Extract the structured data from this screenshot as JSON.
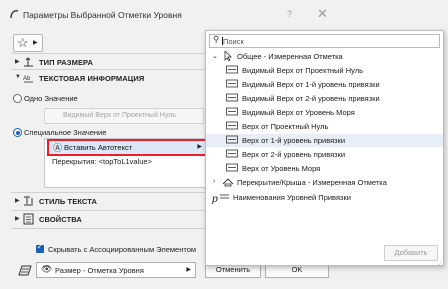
{
  "dialog": {
    "title": "Параметры Выбранной Отметки Уровня",
    "help_label": "?",
    "close_label": "✕",
    "sections": {
      "dimension_type": "ТИП РАЗМЕРА",
      "text_info": "ТЕКСТОВАЯ ИНФОРМАЦИЯ",
      "text_style": "СТИЛЬ ТЕКСТА",
      "properties": "СВОЙСТВА"
    },
    "single_value_label": "Одно Значение",
    "single_value_field": "Видимый Верх от Проектный Нуль",
    "special_value_label": "Специальное Значение",
    "insert_autotext_label": "Вставить Автотекст",
    "textarea_value": "Перекрытия: <topToL1value>",
    "hide_with_associated_label": "Скрывать с Ассоциированным Элементом",
    "preset_label": "Размер - Отметка Уровня",
    "cancel_label": "Отменить",
    "ok_label": "OK"
  },
  "popup": {
    "search_placeholder": "Поиск",
    "tree": [
      {
        "label": "Общее - Измеренная Отметка",
        "level": 0,
        "expanded": true,
        "icon": "cursor-icon"
      },
      {
        "label": "Видимый Верх от Проектный Нуль",
        "level": 1,
        "icon": "level-field-icon"
      },
      {
        "label": "Видимый Верх от 1-й уровень привязки",
        "level": 1,
        "icon": "level-field-icon"
      },
      {
        "label": "Видимый Верх от 2-й уровень привязки",
        "level": 1,
        "icon": "level-field-icon"
      },
      {
        "label": "Видимый Верх от Уровень Моря",
        "level": 1,
        "icon": "level-field-icon"
      },
      {
        "label": "Верх от Проектный Нуль",
        "level": 1,
        "icon": "level-field-icon"
      },
      {
        "label": "Верх от 1-й уровень привязки",
        "level": 1,
        "icon": "level-field-icon",
        "selected": true
      },
      {
        "label": "Верх от 2-й уровень привязки",
        "level": 1,
        "icon": "level-field-icon"
      },
      {
        "label": "Верх от Уровень Моря",
        "level": 1,
        "icon": "level-field-icon"
      },
      {
        "label": "Перекрытие/Крыша - Измеренная Отметка",
        "level": 0,
        "expanded": false,
        "icon": "slab-roof-icon"
      },
      {
        "label": "Наименования Уровней Привязки",
        "level": 0,
        "icon": "reference-level-icon"
      }
    ],
    "add_label": "Добавить"
  },
  "colors": {
    "accent": "#1a5fb4",
    "highlight": "#e8202a",
    "selection": "#e7eef7"
  }
}
